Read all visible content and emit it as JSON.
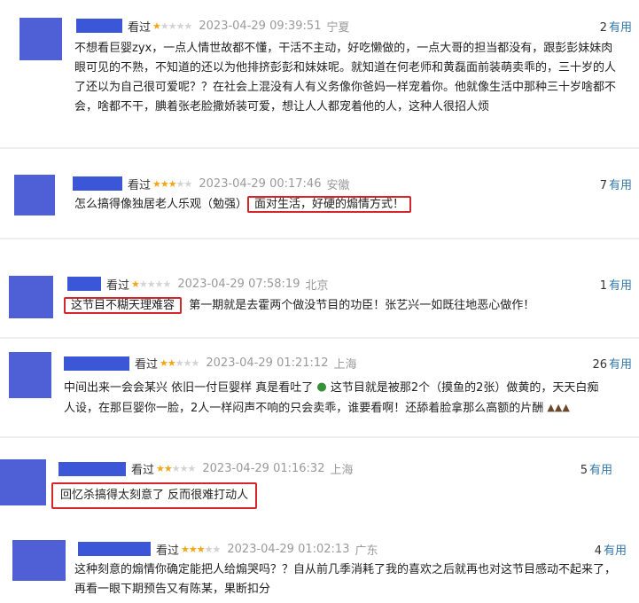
{
  "reviews": [
    {
      "watched": "看过",
      "stars": 1,
      "time": "2023-04-29 09:39:51",
      "location": "宁夏",
      "useful_count": "2",
      "useful_label": "有用",
      "lines": [
        "不想看巨婴zyx，一点人情世故都不懂，干活不主动，好吃懒做的，一点大哥的担当都没有，跟彭彭妹妹肉",
        "眼可见的不熟，不知道的还以为他排挤彭彭和妹妹呢。就知道在何老师和黄磊面前装萌卖乖的，三十岁的人",
        "了还以为自己很可爱呢？？在社会上混没有人有义务像你爸妈一样宠着你。他就像生活中那种三十岁啥都不",
        "会，啥都不干，腆着张老脸撒娇装可爱，想让人人都宠着他的人，这种人很招人烦"
      ]
    },
    {
      "watched": "看过",
      "stars": 3,
      "time": "2023-04-29 00:17:46",
      "location": "安徽",
      "useful_count": "7",
      "useful_label": "有用",
      "text_plain": "怎么搞得像独居老人乐观（勉强）",
      "text_highlight": "面对生活，好硬的煽情方式！"
    },
    {
      "watched": "看过",
      "stars": 1,
      "time": "2023-04-29 07:58:19",
      "location": "北京",
      "useful_count": "1",
      "useful_label": "有用",
      "text_highlight": "这节目不糊天理难容",
      "text_plain": "第一期就是去霍两个做没节目的功臣！张艺兴一如既往地恶心做作！"
    },
    {
      "watched": "看过",
      "stars": 2,
      "time": "2023-04-29 01:21:12",
      "location": "上海",
      "useful_count": "26",
      "useful_label": "有用",
      "line1": "中间出来一会会某兴 依旧一付巨婴样 真是看吐了",
      "line1b": "这节目就是被那2个（摸鱼的2张）做黄的，天天白痴",
      "line2": "人设，在那巨婴你一脸，2人一样闷声不响的只会卖乖，谁要看啊！还舔着脸拿那么高额的片酬"
    },
    {
      "watched": "看过",
      "stars": 2,
      "time": "2023-04-29 01:16:32",
      "location": "上海",
      "useful_count": "5",
      "useful_label": "有用",
      "text_highlight": "回忆杀搞得太刻意了 反而很难打动人"
    },
    {
      "watched": "看过",
      "stars": 3,
      "time": "2023-04-29 01:02:13",
      "location": "广东",
      "useful_count": "4",
      "useful_label": "有用",
      "lines": [
        "这种刻意的煽情你确定能把人给煽哭吗？？自从前几季消耗了我的喜欢之后就再也对这节目感动不起来了，",
        "再看一眼下期预告又有陈某，果断扣分"
      ]
    }
  ],
  "colors": {
    "avatar": "#4f5fd6",
    "name_redaction": "#3c56d8",
    "star_on": "#f2a515",
    "star_off": "#d3d3d3",
    "useful_link": "#3377aa",
    "highlight_box": "#d4262c"
  },
  "icons": [
    "star-icon",
    "vomit-emoji-icon",
    "poop-emoji-icon"
  ]
}
